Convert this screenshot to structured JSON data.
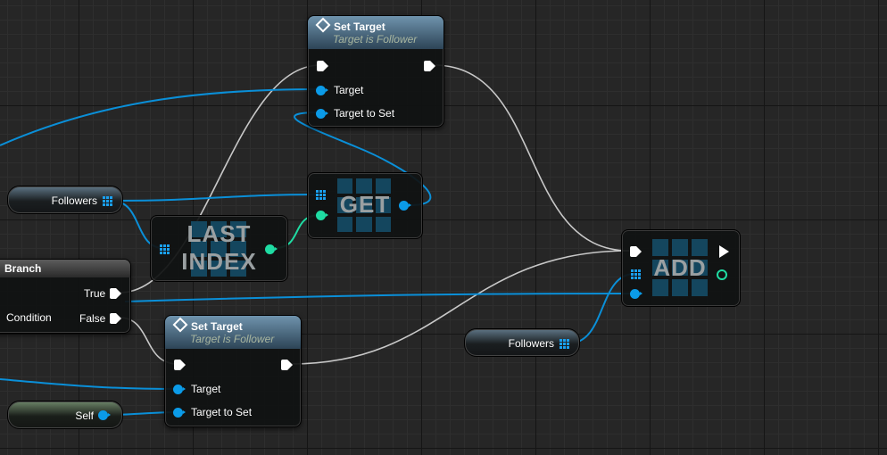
{
  "set_target_top": {
    "title": "Set Target",
    "subtitle": "Target is Follower",
    "pins": {
      "target": "Target",
      "target_to_set": "Target to Set"
    }
  },
  "set_target_bottom": {
    "title": "Set Target",
    "subtitle": "Target is Follower",
    "pins": {
      "target": "Target",
      "target_to_set": "Target to Set"
    }
  },
  "get_node": {
    "title": "GET"
  },
  "last_index_node": {
    "title_line1": "LAST",
    "title_line2": "INDEX"
  },
  "add_node": {
    "title": "ADD"
  },
  "branch_node": {
    "title": "Branch",
    "pins": {
      "true": "True",
      "false": "False",
      "condition": "Condition"
    }
  },
  "variables": {
    "followers_top": "Followers",
    "followers_right": "Followers",
    "self": "Self"
  },
  "colors": {
    "exec_wire": "#d8d8d8",
    "object_pin": "#0b9be8",
    "integer_pin": "#1fdca3",
    "header": "#4f6f88"
  }
}
